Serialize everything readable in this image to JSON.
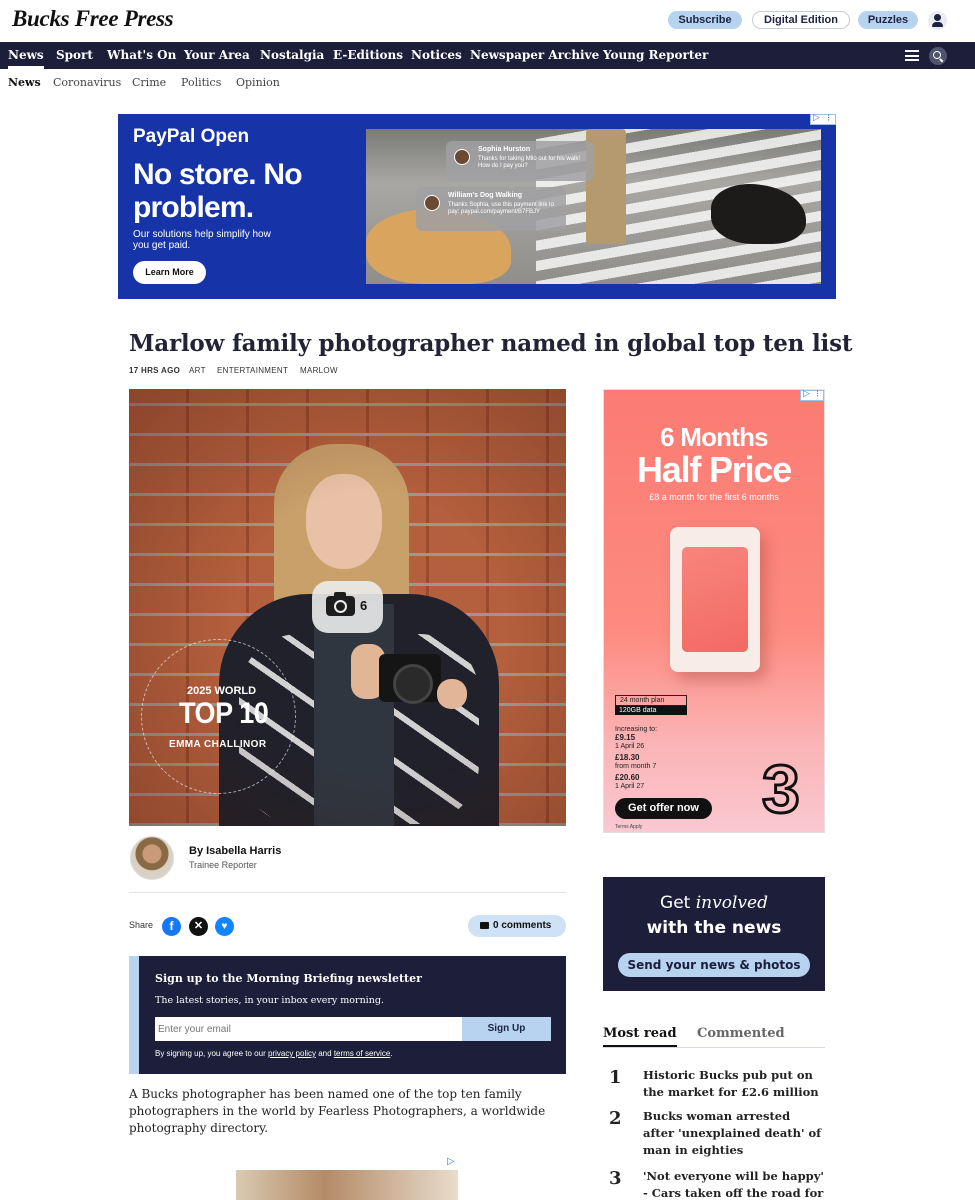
{
  "header": {
    "logo": "Bucks Free Press",
    "subscribe": "Subscribe",
    "digital_edition": "Digital Edition",
    "puzzles": "Puzzles"
  },
  "nav": {
    "items": [
      "News",
      "Sport",
      "What's On",
      "Your Area",
      "Nostalgia",
      "E-Editions",
      "Notices",
      "Newspaper Archive",
      "Young Reporter"
    ]
  },
  "subnav": {
    "items": [
      "News",
      "Coronavirus",
      "Crime",
      "Politics",
      "Opinion"
    ]
  },
  "top_ad": {
    "brand": "PayPal Open",
    "headline": "No store. No problem.",
    "sub": "Our solutions help simplify how you get paid.",
    "cta": "Learn More",
    "chat1_name": "Sophia Hurston",
    "chat1_text": "Thanks for taking Milo out for his walk! How do I pay you?",
    "chat2_name": "William's Dog Walking",
    "chat2_text": "Thanks Sophia, use this payment link to pay: paypal.com/payment/B7FBJY"
  },
  "article": {
    "title": "Marlow family photographer named in global top ten list",
    "time": "17 HRS AGO",
    "tags": [
      "ART",
      "ENTERTAINMENT",
      "MARLOW"
    ],
    "gallery_count": "6",
    "image_badge_year": "2025 WORLD",
    "image_badge_top": "TOP 10",
    "image_badge_name": "EMMA CHALLINOR",
    "author_name": "By Isabella Harris",
    "author_role": "Trainee Reporter",
    "share_label": "Share",
    "comments": "0 comments",
    "body_paragraph": "A Bucks photographer has been named one of the top ten family photographers in the world by Fearless Photographers, a worldwide photography directory."
  },
  "newsletter": {
    "title": "Sign up to the Morning Briefing newsletter",
    "subtitle": "The latest stories, in your inbox every morning.",
    "email_placeholder": "Enter your email",
    "button": "Sign Up",
    "legal_prefix": "By signing up, you agree to our",
    "privacy_link": "privacy policy",
    "legal_and": "and",
    "terms_link": "terms of service",
    "legal_suffix": "."
  },
  "side_ad": {
    "line1": "6 Months",
    "line2": "Half Price",
    "line3": "£8 a month for the first 6 months",
    "plan_term": "24 month plan",
    "plan_data": "120GB data",
    "price1_label": "Increasing to:",
    "price1_value": "£9.15",
    "price1_date": "1 April 26",
    "price2_value": "£18.30",
    "price2_date": "from month 7",
    "price3_value": "£20.60",
    "price3_date": "1 April 27",
    "cta": "Get offer now",
    "logo": "3",
    "terms": "Terms Apply"
  },
  "involved": {
    "line1_prefix": "Get",
    "line1_italic": "involved",
    "line2": "with the news",
    "button": "Send your news & photos"
  },
  "most_read": {
    "tab_active": "Most read",
    "tab_inactive": "Commented",
    "items": [
      {
        "num": "1",
        "text": "Historic Bucks pub put on the market for £2.6 million"
      },
      {
        "num": "2",
        "text": "Bucks woman arrested after 'unexplained death' of man in eighties"
      },
      {
        "num": "3",
        "text": "'Not everyone will be happy' - Cars taken off the road for"
      }
    ]
  },
  "colors": {
    "navy": "#1c1e3a",
    "light_blue": "#b7d3f0",
    "paypal_blue": "#1633a8",
    "three_coral": "#fb7b73"
  }
}
